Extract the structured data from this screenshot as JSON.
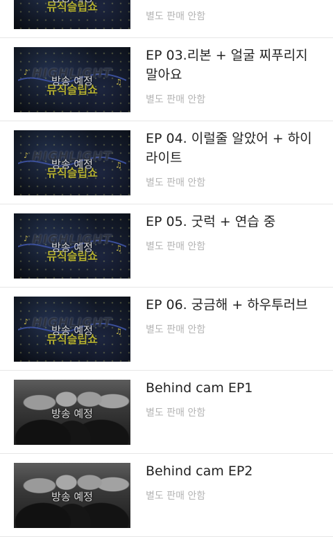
{
  "badge_text": "방송 예정",
  "show_logo": {
    "top": "HIGHLIGHT",
    "bottom": "뮤직슬립쇼"
  },
  "episodes": [
    {
      "title": "",
      "sub": "별도 판매 안함",
      "thumb": "show"
    },
    {
      "title": "EP 03.리본 + 얼굴 찌푸리지 말아요",
      "sub": "별도 판매 안함",
      "thumb": "show"
    },
    {
      "title": "EP 04. 이럴줄 알았어 + 하이라이트",
      "sub": "별도 판매 안함",
      "thumb": "show"
    },
    {
      "title": "EP 05. 굿럭 + 연습 중",
      "sub": "별도 판매 안함",
      "thumb": "show"
    },
    {
      "title": "EP 06. 궁금해 + 하우투러브",
      "sub": "별도 판매 안함",
      "thumb": "show"
    },
    {
      "title": "Behind cam EP1",
      "sub": "별도 판매 안함",
      "thumb": "photo"
    },
    {
      "title": "Behind cam EP2",
      "sub": "별도 판매 안함",
      "thumb": "photo"
    }
  ]
}
